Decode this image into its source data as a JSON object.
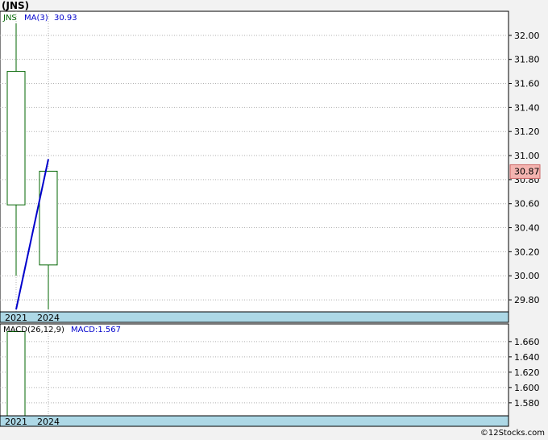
{
  "title": "(JNS)",
  "footer": "©12Stocks.com",
  "colors": {
    "candle": "#006400",
    "ma": "#0000cc",
    "macd": "#0000cc",
    "price_badge_bg": "#f4b4b0",
    "date_bar": "#add8e6",
    "grid": "#b0b0b0"
  },
  "chart_data": [
    {
      "type": "candlestick",
      "legend": {
        "symbol": "JNS",
        "ma_label": "MA(3)",
        "ma_value": "30.93"
      },
      "categories": [
        "2021",
        "2024"
      ],
      "candles": [
        {
          "x": "2021",
          "open": 30.59,
          "close": 31.7,
          "high": 32.1,
          "low": 30.0
        },
        {
          "x": "2024",
          "open": 30.09,
          "close": 30.87,
          "high": 30.87,
          "low": 29.72
        }
      ],
      "ma_line": {
        "name": "MA(3)",
        "points": [
          {
            "x": "2021",
            "y": 29.72
          },
          {
            "x": "2024",
            "y": 30.97
          }
        ]
      },
      "last_price": "30.87",
      "ylim": [
        29.7,
        32.2
      ],
      "yticks": [
        "29.80",
        "30.00",
        "30.20",
        "30.40",
        "30.60",
        "30.80",
        "31.00",
        "31.20",
        "31.40",
        "31.60",
        "31.80",
        "32.00"
      ],
      "grid": true
    },
    {
      "type": "bar",
      "legend": {
        "name": "MACD(26,12,9)",
        "value_label": "MACD:1.567"
      },
      "categories": [
        "2021",
        "2024"
      ],
      "bars": [
        {
          "x": "2021",
          "value": 1.673
        }
      ],
      "ylim": [
        1.563,
        1.683
      ],
      "yticks": [
        "1.580",
        "1.600",
        "1.620",
        "1.640",
        "1.660"
      ],
      "grid": true
    }
  ]
}
